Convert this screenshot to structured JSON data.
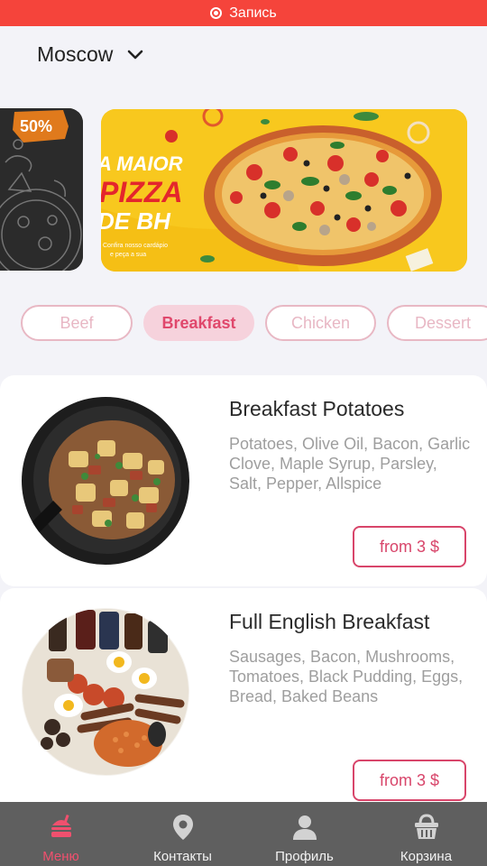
{
  "status_bar": {
    "recording_label": "Запись"
  },
  "header": {
    "city": "Moscow"
  },
  "banners": {
    "left_badge": "50%",
    "main_lines": [
      "A MAIOR",
      "PIZZA",
      "DE BH"
    ],
    "main_small": [
      "Confira nosso cardápio",
      "e peça a sua"
    ]
  },
  "categories": [
    {
      "label": "Beef",
      "active": false
    },
    {
      "label": "Breakfast",
      "active": true
    },
    {
      "label": "Chicken",
      "active": false
    },
    {
      "label": "Dessert",
      "active": false
    }
  ],
  "dishes": [
    {
      "title": "Breakfast Potatoes",
      "ingredients": "Potatoes, Olive Oil, Bacon, Garlic Clove, Maple Syrup, Parsley, Salt, Pepper, Allspice",
      "price": "from 3 $"
    },
    {
      "title": "Full English Breakfast",
      "ingredients": "Sausages, Bacon, Mushrooms, Tomatoes, Black Pudding, Eggs, Bread, Baked Beans",
      "price": "from 3 $"
    }
  ],
  "tabbar": {
    "tabs": [
      {
        "label": "Меню",
        "icon": "burger-icon",
        "active": true
      },
      {
        "label": "Контакты",
        "icon": "location-pin-icon",
        "active": false
      },
      {
        "label": "Профиль",
        "icon": "person-icon",
        "active": false
      },
      {
        "label": "Корзина",
        "icon": "basket-icon",
        "active": false
      }
    ]
  },
  "colors": {
    "accent": "#e0486c",
    "record_bar": "#f5443b",
    "tabbar": "#5f5f5f",
    "banner_yellow": "#f8c81e"
  }
}
